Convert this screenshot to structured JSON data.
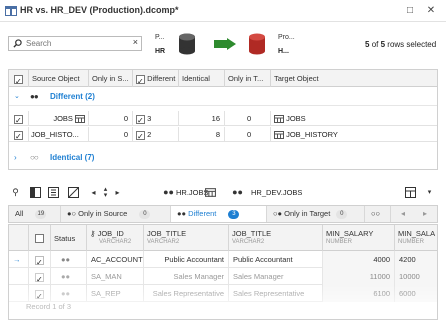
{
  "window": {
    "title": "HR vs. HR_DEV (Production).dcomp*",
    "restore_glyph": "□",
    "close_glyph": "✕"
  },
  "summary": {
    "search_placeholder": "Search",
    "clear_glyph": "×",
    "source": {
      "label": "P...",
      "name": "HR",
      "color": "#333333"
    },
    "target": {
      "label": "Pro...",
      "name": "H...",
      "color": "#c0312b"
    },
    "arrow_color": "#2e8b2e",
    "rows_selected_count": "5",
    "rows_of": "of",
    "rows_total": "5",
    "rows_suffix": "rows selected"
  },
  "objects_grid": {
    "columns": [
      "Source Object",
      "Only in S...",
      "Different",
      "Identical",
      "Only in T...",
      "Target Object"
    ],
    "groups": [
      {
        "label": "Different (2)",
        "expanded": true,
        "rows": [
          {
            "source": "JOBS",
            "only_in_source": "0",
            "different": "3",
            "identical": "16",
            "only_in_target": "0",
            "target": "JOBS"
          },
          {
            "source": "JOB_HISTO...",
            "only_in_source": "0",
            "different": "2",
            "identical": "8",
            "only_in_target": "0",
            "target": "JOB_HISTORY"
          }
        ]
      },
      {
        "label": "Identical (7)",
        "expanded": false
      }
    ]
  },
  "detail_toolbar": {
    "source_table": "HR.JOBS",
    "target_table": "HR_DEV.JOBS"
  },
  "tabs": [
    {
      "label": "All",
      "count": "19"
    },
    {
      "label": "Only in Source",
      "count": "0"
    },
    {
      "label": "Different",
      "count": "3",
      "active": true
    },
    {
      "label": "Only in Target",
      "count": "0"
    },
    {
      "label": "",
      "count": ""
    }
  ],
  "records_grid": {
    "columns": [
      {
        "label": "Status",
        "type": ""
      },
      {
        "label": "JOB_ID",
        "type": "VARCHAR2"
      },
      {
        "label": "JOB_TITLE",
        "type": "VARCHAR2"
      },
      {
        "label": "JOB_TITLE",
        "type": "VARCHAR2"
      },
      {
        "label": "MIN_SALARY",
        "type": "NUMBER"
      },
      {
        "label": "MIN_SALA",
        "type": "NUMBER"
      }
    ],
    "rows": [
      {
        "job_id": "AC_ACCOUNT",
        "src_title": "Public Accountant",
        "tgt_title": "Public Accountant",
        "src_min": "4000",
        "tgt_min": "4200"
      },
      {
        "job_id": "SA_MAN",
        "src_title": "Sales Manager",
        "tgt_title": "Sales Manager",
        "src_min": "11000",
        "tgt_min": "10000"
      },
      {
        "job_id": "SA_REP",
        "src_title": "Sales Representative",
        "tgt_title": "Sales Representative",
        "src_min": "6100",
        "tgt_min": "6000"
      }
    ],
    "record_info": "Record 1 of 3"
  }
}
